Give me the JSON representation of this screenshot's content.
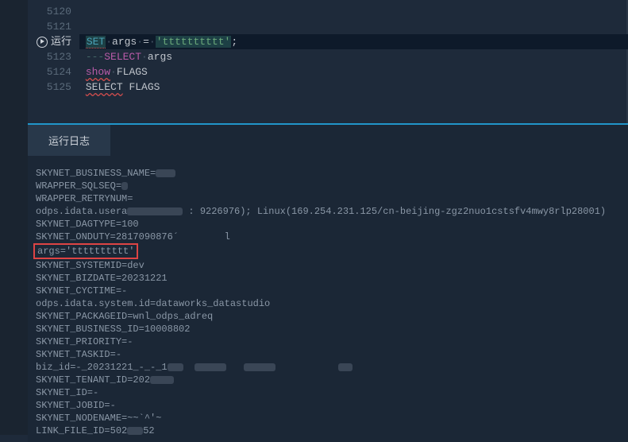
{
  "editor": {
    "lines": [
      {
        "num": "5120",
        "tokens": []
      },
      {
        "num": "5121",
        "tokens": []
      },
      {
        "num": "",
        "run_label": "运行",
        "tokens": []
      },
      {
        "num": "5123",
        "tokens": []
      },
      {
        "num": "5124",
        "tokens": []
      },
      {
        "num": "5125",
        "tokens": []
      }
    ],
    "code": {
      "set_kw": "SET",
      "args_ident": "args",
      "eq": "=",
      "args_value": "'tttttttttt'",
      "semi": ";",
      "dashes": "---",
      "select_kw": "SELECT",
      "args_ref": "args",
      "show_kw": "show",
      "flags_ident": "FLAGS",
      "select2": "SELECT",
      "flags2": "FLAGS"
    }
  },
  "tabs": {
    "log_tab": "运行日志"
  },
  "log": {
    "l1": "SKYNET_BUSINESS_NAME=",
    "l2": "WRAPPER_SQLSEQ=",
    "l3": "WRAPPER_RETRYNUM=",
    "l4a": "odps.idata.usera",
    "l4b": ": 9226976); Linux(169.254.231.125/cn-beijing-zgz2nuo1cstsfv4mwy8rlp28001)",
    "l5": "SKYNET_DAGTYPE=100",
    "l6": "SKYNET_ONDUTY=2817090876´        l",
    "l7": "args='tttttttttt'",
    "l8": "SKYNET_SYSTEMID=dev",
    "l9": "SKYNET_BIZDATE=20231221",
    "l10": "SKYNET_CYCTIME=-",
    "l11": "odps.idata.system.id=dataworks_datastudio",
    "l12": "SKYNET_PACKAGEID=wnl_odps_adreq",
    "l13": "SKYNET_BUSINESS_ID=10008802",
    "l14": "SKYNET_PRIORITY=-",
    "l15": "SKYNET_TASKID=-",
    "l16": "biz_id=-_20231221_-_-_1",
    "l17": "SKYNET_TENANT_ID=202",
    "l18": "SKYNET_ID=-",
    "l19": "SKYNET_JOBID=-",
    "l20": "SKYNET_NODENAME=~~`^'~",
    "l21a": "LINK_FILE_ID=502",
    "l21b": "52"
  }
}
